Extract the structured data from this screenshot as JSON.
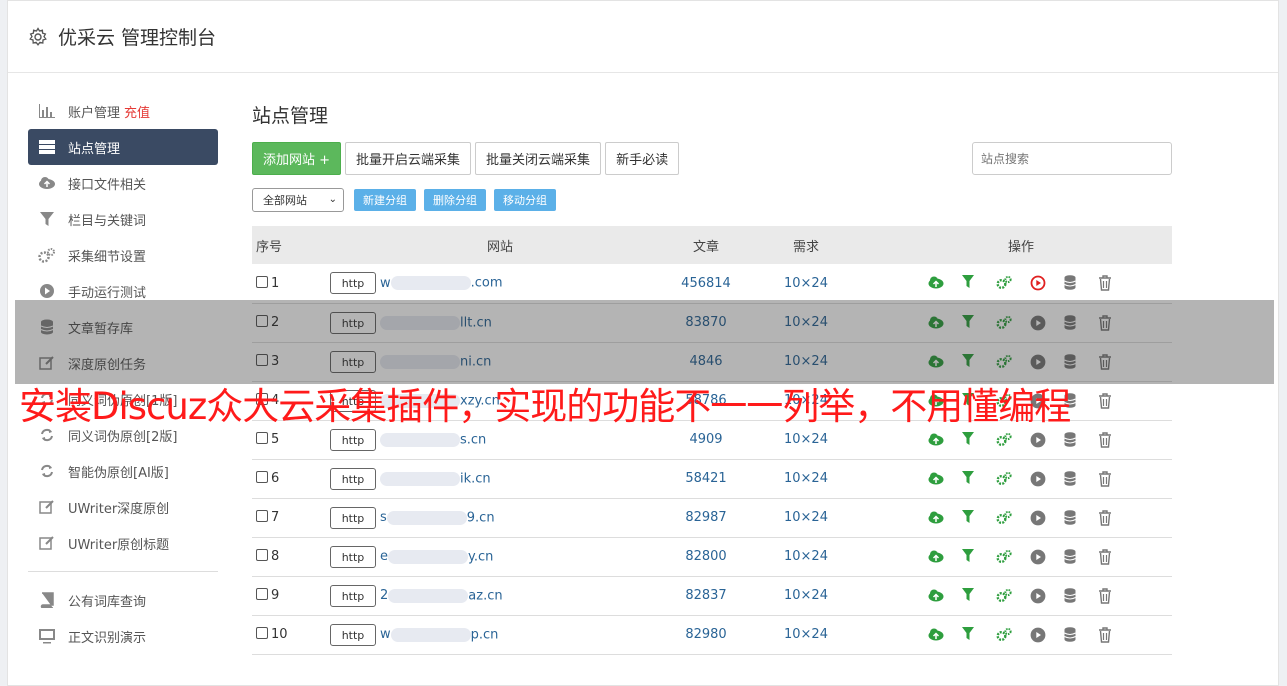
{
  "header": {
    "title": "优采云 管理控制台"
  },
  "sidebar": {
    "items": [
      {
        "label": "账户管理",
        "extra": "充值",
        "icon": "bar-chart-icon"
      },
      {
        "label": "站点管理",
        "icon": "server-icon",
        "active": true
      },
      {
        "label": "接口文件相关",
        "icon": "cloud-upload-icon"
      },
      {
        "label": "栏目与关键词",
        "icon": "filter-icon"
      },
      {
        "label": "采集细节设置",
        "icon": "gears-icon"
      },
      {
        "label": "手动运行测试",
        "icon": "play-icon"
      },
      {
        "label": "文章暂存库",
        "icon": "database-icon"
      },
      {
        "label": "深度原创任务",
        "icon": "edit-icon"
      },
      {
        "label": "同义词伪原创[1版]",
        "icon": "refresh-icon"
      },
      {
        "label": "同义词伪原创[2版]",
        "icon": "refresh-icon"
      },
      {
        "label": "智能伪原创[AI版]",
        "icon": "refresh-icon"
      },
      {
        "label": "UWriter深度原创",
        "icon": "edit-icon"
      },
      {
        "label": "UWriter原创标题",
        "icon": "edit-icon"
      }
    ],
    "bottom_items": [
      {
        "label": "公有词库查询",
        "icon": "book-icon"
      },
      {
        "label": "正文识别演示",
        "icon": "monitor-icon"
      }
    ]
  },
  "main": {
    "title": "站点管理",
    "buttons": {
      "add_site": "添加网站 +",
      "batch_open": "批量开启云端采集",
      "batch_close": "批量关闭云端采集",
      "newbie": "新手必读"
    },
    "search_placeholder": "站点搜索",
    "group_select": "全部网站",
    "group_buttons": {
      "new": "新建分组",
      "delete": "删除分组",
      "move": "移动分组"
    },
    "table": {
      "headers": {
        "no": "序号",
        "site": "网站",
        "articles": "文章",
        "demand": "需求",
        "ops": "操作"
      },
      "http_label": "http",
      "rows": [
        {
          "no": "1",
          "prefix": "w",
          "domain": ".com",
          "articles": "456814",
          "demand": "10×24",
          "running": true
        },
        {
          "no": "2",
          "prefix": "",
          "domain": "llt.cn",
          "articles": "83870",
          "demand": "10×24",
          "running": false
        },
        {
          "no": "3",
          "prefix": "",
          "domain": "ni.cn",
          "articles": "4846",
          "demand": "10×24",
          "running": false
        },
        {
          "no": "4",
          "prefix": "",
          "domain": "xzy.cn",
          "articles": "58786",
          "demand": "10×24",
          "running": false
        },
        {
          "no": "5",
          "prefix": "",
          "domain": "s.cn",
          "articles": "4909",
          "demand": "10×24",
          "running": false
        },
        {
          "no": "6",
          "prefix": "",
          "domain": "ik.cn",
          "articles": "58421",
          "demand": "10×24",
          "running": false
        },
        {
          "no": "7",
          "prefix": "s",
          "domain": "9.cn",
          "articles": "82987",
          "demand": "10×24",
          "running": false
        },
        {
          "no": "8",
          "prefix": "e",
          "domain": "y.cn",
          "articles": "82800",
          "demand": "10×24",
          "running": false
        },
        {
          "no": "9",
          "prefix": "2",
          "domain": "az.cn",
          "articles": "82837",
          "demand": "10×24",
          "running": false
        },
        {
          "no": "10",
          "prefix": "w",
          "domain": "p.cn",
          "articles": "82980",
          "demand": "10×24",
          "running": false
        }
      ]
    }
  },
  "banner": {
    "text": "安装Discuz众大云采集插件，实现的功能不一一列举，不用懂编程"
  },
  "colors": {
    "accent_green": "#5cb85c",
    "nav_active": "#3a4a63",
    "link": "#2a6496",
    "banner_red": "#ff1a1a",
    "small_button": "#5bb0e8"
  }
}
